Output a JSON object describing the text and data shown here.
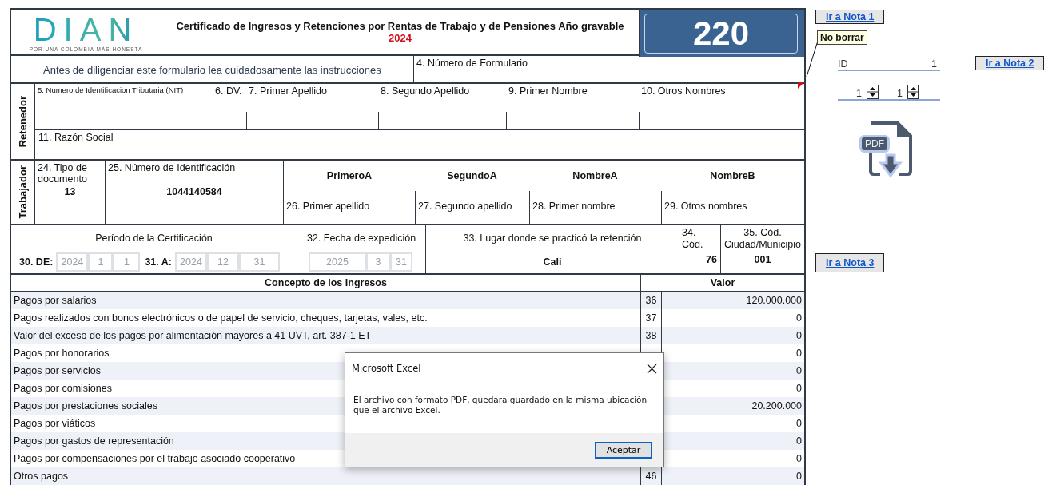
{
  "logo": {
    "wordmark": "DIAN",
    "tagline": "POR UNA COLOMBIA MÁS HONESTA"
  },
  "header": {
    "title": "Certificado de Ingresos y Retenciones por Rentas de Trabajo y de Pensiones Año gravable",
    "year": "2024",
    "form_code": "220"
  },
  "instructions": "Antes de diligenciar este formulario lea cuidadosamente las instrucciones",
  "form_number": {
    "label": "4. Número de Formulario",
    "has_comment": true
  },
  "retenedor": {
    "title": "Retenedor",
    "fields": [
      {
        "label": "5. Numero de Identificacion Tributaria (NIT)",
        "kind": "small"
      },
      {
        "label": "6. DV.",
        "kind": "normal"
      },
      {
        "label": "7. Primer Apellido",
        "kind": "normal"
      },
      {
        "label": "8. Segundo Apellido",
        "kind": "normal"
      },
      {
        "label": "9. Primer Nombre",
        "kind": "normal"
      },
      {
        "label": "10. Otros Nombres",
        "kind": "normal"
      }
    ],
    "business_name_label": "11.  Razón Social"
  },
  "trabajador": {
    "title": "Trabajador",
    "doc_type": {
      "label": "24. Tipo de documento",
      "value": "13"
    },
    "id_number": {
      "label": "25. Número de Identificación",
      "value": "1044140584"
    },
    "names": [
      {
        "value": "PrimeroA",
        "label": "26. Primer apellido"
      },
      {
        "value": "SegundoA",
        "label": "27. Segundo apellido"
      },
      {
        "value": "NombreA",
        "label": "28. Primer nombre"
      },
      {
        "value": "NombreB",
        "label": "29. Otros nombres"
      }
    ]
  },
  "period": {
    "label": "Período de la Certificación",
    "from_label": "30. DE:",
    "from": [
      "2024",
      "1",
      "1"
    ],
    "to_label": "31. A:",
    "to": [
      "2024",
      "12",
      "31"
    ]
  },
  "issue_date": {
    "label": "32. Fecha de expedición",
    "date": [
      "2025",
      "3",
      "31"
    ]
  },
  "place": {
    "label": "33. Lugar donde se practicó la retención",
    "value": "Cali"
  },
  "department_code": {
    "label": "34. Cód.",
    "value": "76"
  },
  "city_code": {
    "label": "35. Cód. Ciudad/Municipio",
    "value": "001"
  },
  "income_table": {
    "columns": [
      "Concepto de los Ingresos",
      "Valor"
    ],
    "rows": [
      {
        "concept": "Pagos por salarios",
        "code": "36",
        "value": "120.000.000"
      },
      {
        "concept": "Pagos realizados con bonos electrónicos o de papel de servicio, cheques, tarjetas, vales, etc.",
        "code": "37",
        "value": "0"
      },
      {
        "concept": "Valor del exceso de los pagos por alimentación mayores a 41 UVT, art. 387-1 ET",
        "code": "38",
        "value": "0"
      },
      {
        "concept": "Pagos por honorarios",
        "value": "0"
      },
      {
        "concept": "Pagos por servicios",
        "value": "0"
      },
      {
        "concept": "Pagos por comisiones",
        "value": "0"
      },
      {
        "concept": "Pagos por prestaciones sociales",
        "value": "20.200.000"
      },
      {
        "concept": "Pagos por viáticos",
        "value": "0"
      },
      {
        "concept": "Pagos por gastos de representación",
        "value": "0"
      },
      {
        "concept": "Pagos por compensaciones por el trabajo asociado cooperativo",
        "value": "0"
      },
      {
        "concept": "Otros pagos",
        "code": "46",
        "value": "0"
      }
    ]
  },
  "side": {
    "note_buttons": [
      "Ir a Nota 1",
      "Ir a Nota 2",
      "Ir a Nota 3"
    ],
    "comment": "No borrar",
    "id_label": "ID",
    "id_value": "1",
    "spinners": [
      "1",
      "1"
    ],
    "pdf_label": "PDF"
  },
  "dialog": {
    "title": "Microsoft Excel",
    "message": "El archivo con formato PDF, quedara guardado en la misma ubicación que el archivo Excel.",
    "button": "Aceptar"
  }
}
